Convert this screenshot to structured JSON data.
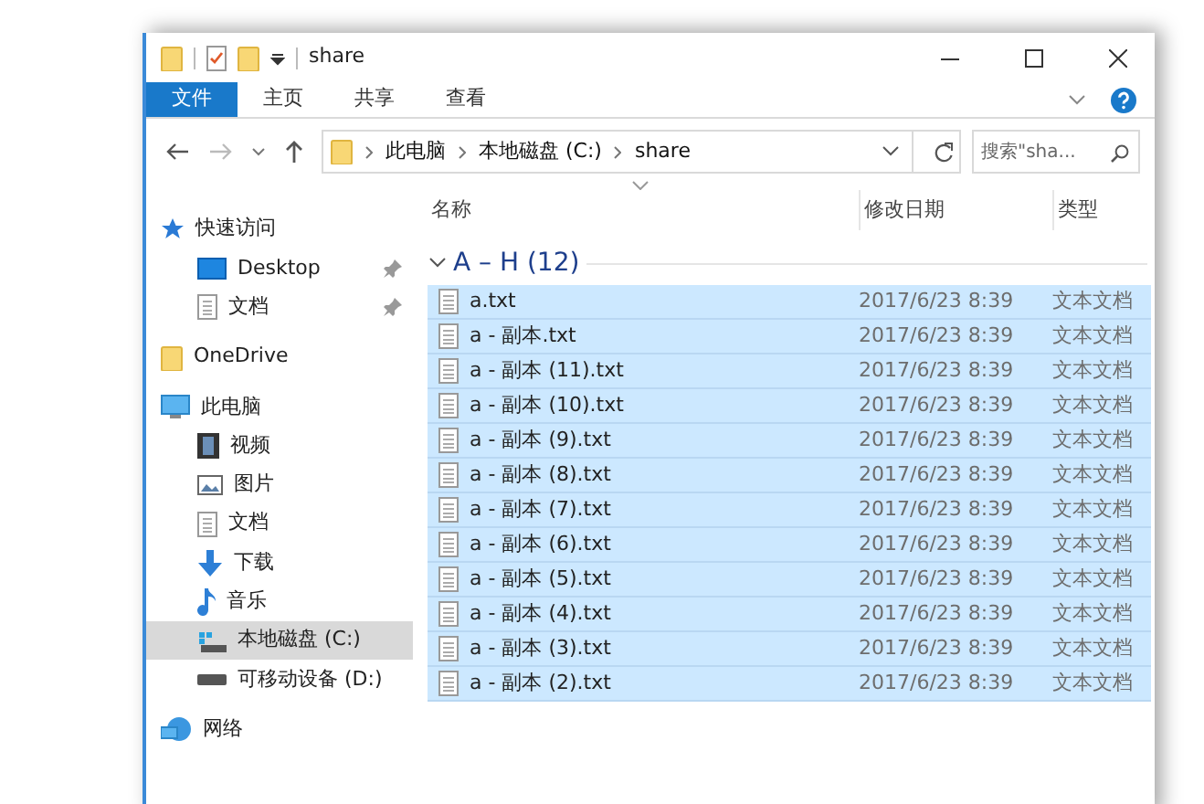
{
  "window": {
    "title": "share"
  },
  "ribbon": {
    "tabs": [
      {
        "label": "文件",
        "selected": true
      },
      {
        "label": "主页",
        "selected": false
      },
      {
        "label": "共享",
        "selected": false
      },
      {
        "label": "查看",
        "selected": false
      }
    ]
  },
  "address_bar": {
    "breadcrumb": [
      "此电脑",
      "本地磁盘 (C:)",
      "share"
    ],
    "search_placeholder": "搜索\"sha..."
  },
  "nav_pane": [
    {
      "label": "快速访问",
      "kind": "star",
      "selected": false,
      "children": [
        {
          "label": "Desktop",
          "kind": "desktop",
          "selected": false,
          "pinned": true
        },
        {
          "label": "文档",
          "kind": "document",
          "selected": false,
          "pinned": true
        }
      ]
    },
    {
      "label": "OneDrive",
      "kind": "folder",
      "selected": false
    },
    {
      "label": "此电脑",
      "kind": "computer",
      "selected": false,
      "children": [
        {
          "label": "视频",
          "kind": "video",
          "selected": false
        },
        {
          "label": "图片",
          "kind": "picture",
          "selected": false
        },
        {
          "label": "文档",
          "kind": "document",
          "selected": false
        },
        {
          "label": "下载",
          "kind": "download",
          "selected": false
        },
        {
          "label": "音乐",
          "kind": "music",
          "selected": false
        },
        {
          "label": "本地磁盘 (C:)",
          "kind": "system-drive",
          "selected": true
        },
        {
          "label": "可移动设备 (D:)",
          "kind": "drive",
          "selected": false
        }
      ]
    },
    {
      "label": "网络",
      "kind": "network",
      "selected": false
    }
  ],
  "file_list": {
    "columns": [
      "名称",
      "修改日期",
      "类型"
    ],
    "group": {
      "label": "A – H (12)",
      "expanded": true
    },
    "rows": [
      {
        "name": "a.txt",
        "modified": "2017/6/23 8:39",
        "type": "文本文档",
        "selected": true
      },
      {
        "name": "a - 副本.txt",
        "modified": "2017/6/23 8:39",
        "type": "文本文档",
        "selected": true
      },
      {
        "name": "a - 副本 (11).txt",
        "modified": "2017/6/23 8:39",
        "type": "文本文档",
        "selected": true
      },
      {
        "name": "a - 副本 (10).txt",
        "modified": "2017/6/23 8:39",
        "type": "文本文档",
        "selected": true
      },
      {
        "name": "a - 副本 (9).txt",
        "modified": "2017/6/23 8:39",
        "type": "文本文档",
        "selected": true
      },
      {
        "name": "a - 副本 (8).txt",
        "modified": "2017/6/23 8:39",
        "type": "文本文档",
        "selected": true
      },
      {
        "name": "a - 副本 (7).txt",
        "modified": "2017/6/23 8:39",
        "type": "文本文档",
        "selected": true
      },
      {
        "name": "a - 副本 (6).txt",
        "modified": "2017/6/23 8:39",
        "type": "文本文档",
        "selected": true
      },
      {
        "name": "a - 副本 (5).txt",
        "modified": "2017/6/23 8:39",
        "type": "文本文档",
        "selected": true
      },
      {
        "name": "a - 副本 (4).txt",
        "modified": "2017/6/23 8:39",
        "type": "文本文档",
        "selected": true
      },
      {
        "name": "a - 副本 (3).txt",
        "modified": "2017/6/23 8:39",
        "type": "文本文档",
        "selected": true
      },
      {
        "name": "a - 副本 (2).txt",
        "modified": "2017/6/23 8:39",
        "type": "文本文档",
        "selected": true
      }
    ]
  }
}
